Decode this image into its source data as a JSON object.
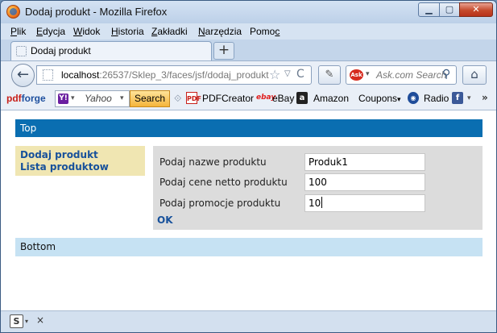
{
  "window": {
    "title": "Dodaj produkt - Mozilla Firefox",
    "min_glyph": "▁",
    "max_glyph": "▢",
    "close_glyph": "✕"
  },
  "menu": {
    "items": [
      {
        "accel": "P",
        "rest": "lik"
      },
      {
        "accel": "E",
        "rest": "dycja"
      },
      {
        "accel": "W",
        "rest": "idok"
      },
      {
        "accel": "H",
        "rest": "istoria"
      },
      {
        "accel": "Z",
        "rest": "akładki"
      },
      {
        "accel": "N",
        "rest": "arzędzia"
      },
      {
        "pre": "Pomo",
        "accel": "c",
        "rest": ""
      }
    ]
  },
  "tabs": {
    "active_label": "Dodaj produkt",
    "new_tab_glyph": "+"
  },
  "nav": {
    "back_glyph": "←",
    "url_host": "localhost",
    "url_rest": ":26537/Sklep_3/faces/jsf/dodaj_produkt",
    "star_glyph": "☆",
    "drop_glyph": "▽",
    "reload_glyph": "C",
    "search_placeholder": "Ask.com Search",
    "search_engine_logo": "Ask",
    "search_glyph": "⚲",
    "home_glyph": "⌂"
  },
  "toolbar": {
    "pdfforge_prefix": "pdf",
    "pdfforge_suffix": "forge",
    "yahoo_logo": "Y!",
    "yahoo_text": "Yahoo",
    "search_button": "Search",
    "items": {
      "pdfcreator": "PDFCreator",
      "ebay": "eBay",
      "amazon": "Amazon",
      "coupons": "Coupons",
      "radio": "Radio"
    },
    "ebay_icon": "ebay",
    "amazon_icon": "a",
    "radio_icon": "◉",
    "facebook_icon": "f",
    "pdf_icon": "PDF",
    "more_glyph": "»"
  },
  "page": {
    "top": "Top",
    "bottom": "Bottom",
    "nav_links": [
      "Dodaj produkt",
      "Lista produktow"
    ],
    "form": {
      "fields": [
        {
          "label": "Podaj nazwe produktu",
          "value": "Produk1"
        },
        {
          "label": "Podaj cene netto produktu",
          "value": "100"
        },
        {
          "label": "Podaj promocje produktu",
          "value": "10"
        }
      ],
      "submit": "OK"
    }
  },
  "statusbar": {
    "addon_glyph": "S",
    "close_glyph": "×"
  },
  "colors": {
    "top_bar": "#0a6eb1",
    "bottom_bar": "#c6e2f3",
    "nav_panel": "#f0e6b2",
    "form_panel": "#dcdcdc",
    "link": "#17519b"
  }
}
